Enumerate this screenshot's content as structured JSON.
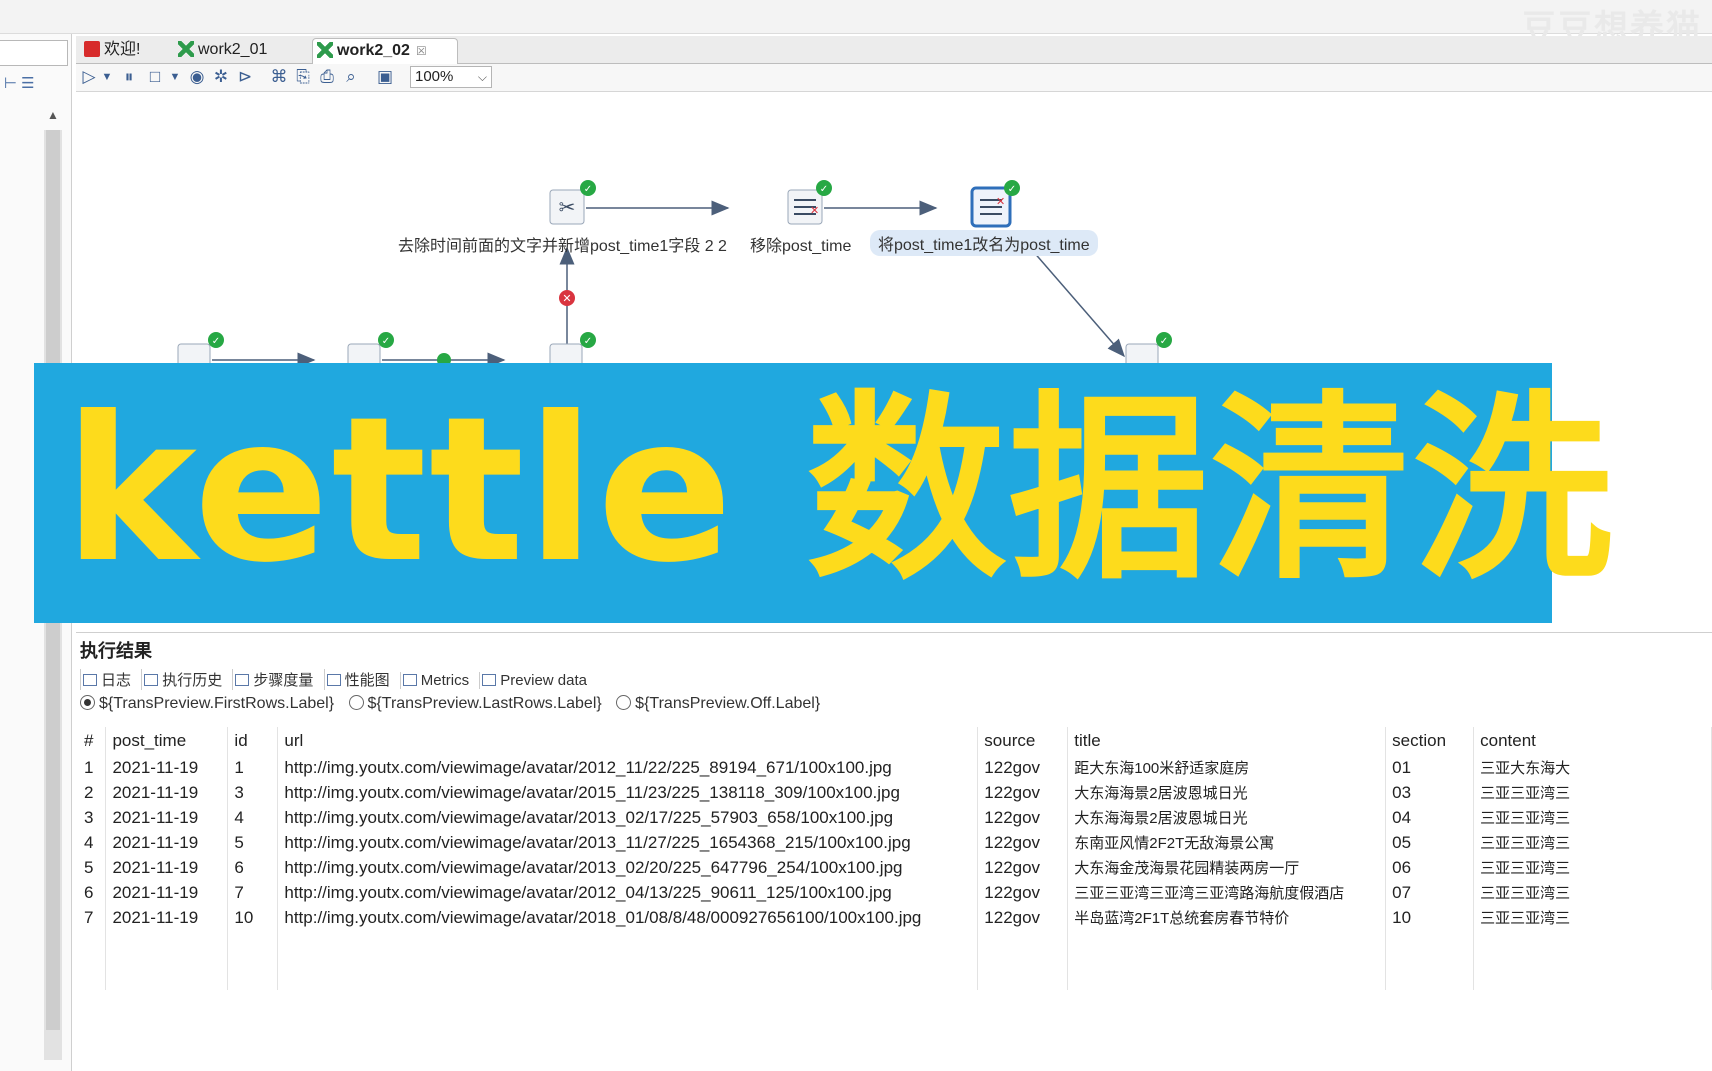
{
  "watermark": "豆豆想养猫",
  "tabs": [
    {
      "label": "欢迎!"
    },
    {
      "label": "work2_01"
    },
    {
      "label": "work2_02",
      "active": true,
      "close": "☒"
    }
  ],
  "toolbar": {
    "icons": [
      "run-icon",
      "run-dropdown-icon",
      "pause-icon",
      "stop-icon",
      "stop-dropdown-icon",
      "preview-icon",
      "debug-icon",
      "replay-icon",
      "verify-icon",
      "impact-icon",
      "sql-icon",
      "explore-db-icon",
      "layout-icon"
    ],
    "zoom": "100%"
  },
  "canvas": {
    "steps": [
      {
        "label": "去除时间前面的文字并新增post_time1字段 2 2"
      },
      {
        "label": "移除post_time"
      },
      {
        "label": "将post_time1改名为post_time"
      }
    ]
  },
  "banner": {
    "text": "kettle  数据清洗",
    "bg": "#20a8df",
    "fg": "#fddb1c"
  },
  "panel": {
    "title": "执行结果",
    "result_tabs": [
      "日志",
      "执行历史",
      "步骤度量",
      "性能图",
      "Metrics",
      "Preview data"
    ],
    "radios": [
      {
        "label": "${TransPreview.FirstRows.Label}",
        "selected": true
      },
      {
        "label": "${TransPreview.LastRows.Label}",
        "selected": false
      },
      {
        "label": "${TransPreview.Off.Label}",
        "selected": false
      }
    ]
  },
  "table": {
    "columns": [
      "#",
      "post_time",
      "id",
      "url",
      "source",
      "title",
      "section",
      "content"
    ],
    "rows": [
      [
        "1",
        "2021-11-19",
        "1",
        "http://img.youtx.com/viewimage/avatar/2012_11/22/225_89194_671/100x100.jpg",
        "122gov",
        "距大东海100米舒适家庭房",
        "01",
        "三亚大东海大"
      ],
      [
        "2",
        "2021-11-19",
        "3",
        "http://img.youtx.com/viewimage/avatar/2015_11/23/225_138118_309/100x100.jpg",
        "122gov",
        "大东海海景2居波恩城日光",
        "03",
        "三亚三亚湾三"
      ],
      [
        "3",
        "2021-11-19",
        "4",
        "http://img.youtx.com/viewimage/avatar/2013_02/17/225_57903_658/100x100.jpg",
        "122gov",
        "大东海海景2居波恩城日光",
        "04",
        "三亚三亚湾三"
      ],
      [
        "4",
        "2021-11-19",
        "5",
        "http://img.youtx.com/viewimage/avatar/2013_11/27/225_1654368_215/100x100.jpg",
        "122gov",
        "东南亚风情2F2T无敌海景公寓",
        "05",
        "三亚三亚湾三"
      ],
      [
        "5",
        "2021-11-19",
        "6",
        "http://img.youtx.com/viewimage/avatar/2013_02/20/225_647796_254/100x100.jpg",
        "122gov",
        "大东海金茂海景花园精装两房一厅",
        "06",
        "三亚三亚湾三"
      ],
      [
        "6",
        "2021-11-19",
        "7",
        "http://img.youtx.com/viewimage/avatar/2012_04/13/225_90611_125/100x100.jpg",
        "122gov",
        "三亚三亚湾三亚湾三亚湾路海航度假酒店",
        "07",
        "三亚三亚湾三"
      ],
      [
        "7",
        "2021-11-19",
        "10",
        "http://img.youtx.com/viewimage/avatar/2018_01/08/8/48/000927656100/100x100.jpg",
        "122gov",
        "半岛蓝湾2F1T总统套房春节特价",
        "10",
        "三亚三亚湾三"
      ]
    ]
  }
}
